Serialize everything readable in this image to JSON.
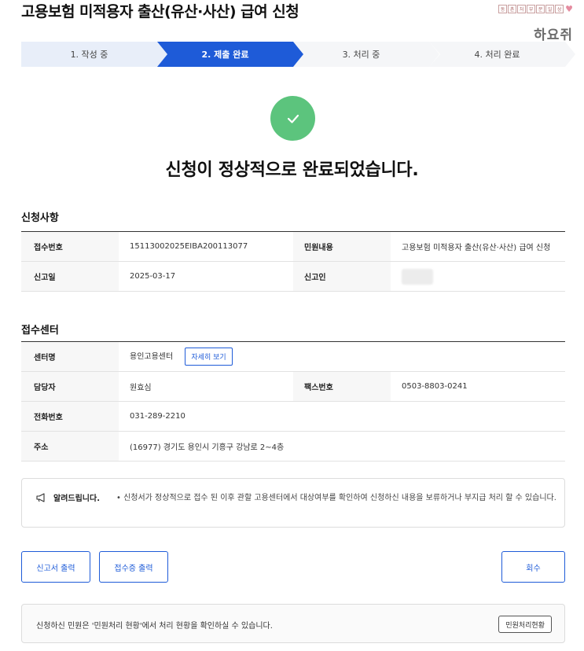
{
  "header": {
    "title": "고용보험 미적용자 출산(유산·사산) 급여 신청",
    "brand": "하요쥐",
    "stamp_chars": [
      "동",
      "촌",
      "처",
      "부",
      "분",
      "일",
      "상"
    ]
  },
  "steps": [
    {
      "label": "1. 작성 중",
      "state": "done"
    },
    {
      "label": "2. 제출 완료",
      "state": "current"
    },
    {
      "label": "3. 처리 중",
      "state": "pending"
    },
    {
      "label": "4. 처리 완료",
      "state": "pending"
    }
  ],
  "status_message": "신청이 정상적으로 완료되었습니다.",
  "application": {
    "title": "신청사항",
    "receipt_no_label": "접수번호",
    "receipt_no": "15113002025EIBA200113077",
    "complaint_label": "민원내용",
    "complaint": "고용보험 미적용자 출산(유산·사산) 급여 신청",
    "date_label": "신고일",
    "date": "2025-03-17",
    "reporter_label": "신고인"
  },
  "center": {
    "title": "접수센터",
    "name_label": "센터명",
    "name": "용인고용센터",
    "detail_button": "자세히 보기",
    "manager_label": "담당자",
    "manager": "원효심",
    "fax_label": "팩스번호",
    "fax": "0503-8803-0241",
    "phone_label": "전화번호",
    "phone": "031-289-2210",
    "address_label": "주소",
    "address": "(16977) 경기도 용인시 기흥구 강남로 2~4층"
  },
  "notice": {
    "heading": "알려드립니다.",
    "body": "• 신청서가 정상적으로 접수 된 이후 관할 고용센터에서 대상여부를 확인하여 신청하신 내용을 보류하거나 부지급 처리 할 수 있습니다."
  },
  "actions": {
    "print_report": "신고서 출력",
    "print_receipt": "접수증 출력",
    "withdraw": "회수"
  },
  "footer": {
    "text": "신청하신 민원은 '민원처리 현황'에서 처리 현황을 확인하실 수 있습니다.",
    "button": "민원처리현황"
  },
  "colors": {
    "accent": "#1e5bd8",
    "success": "#5cc47d"
  }
}
